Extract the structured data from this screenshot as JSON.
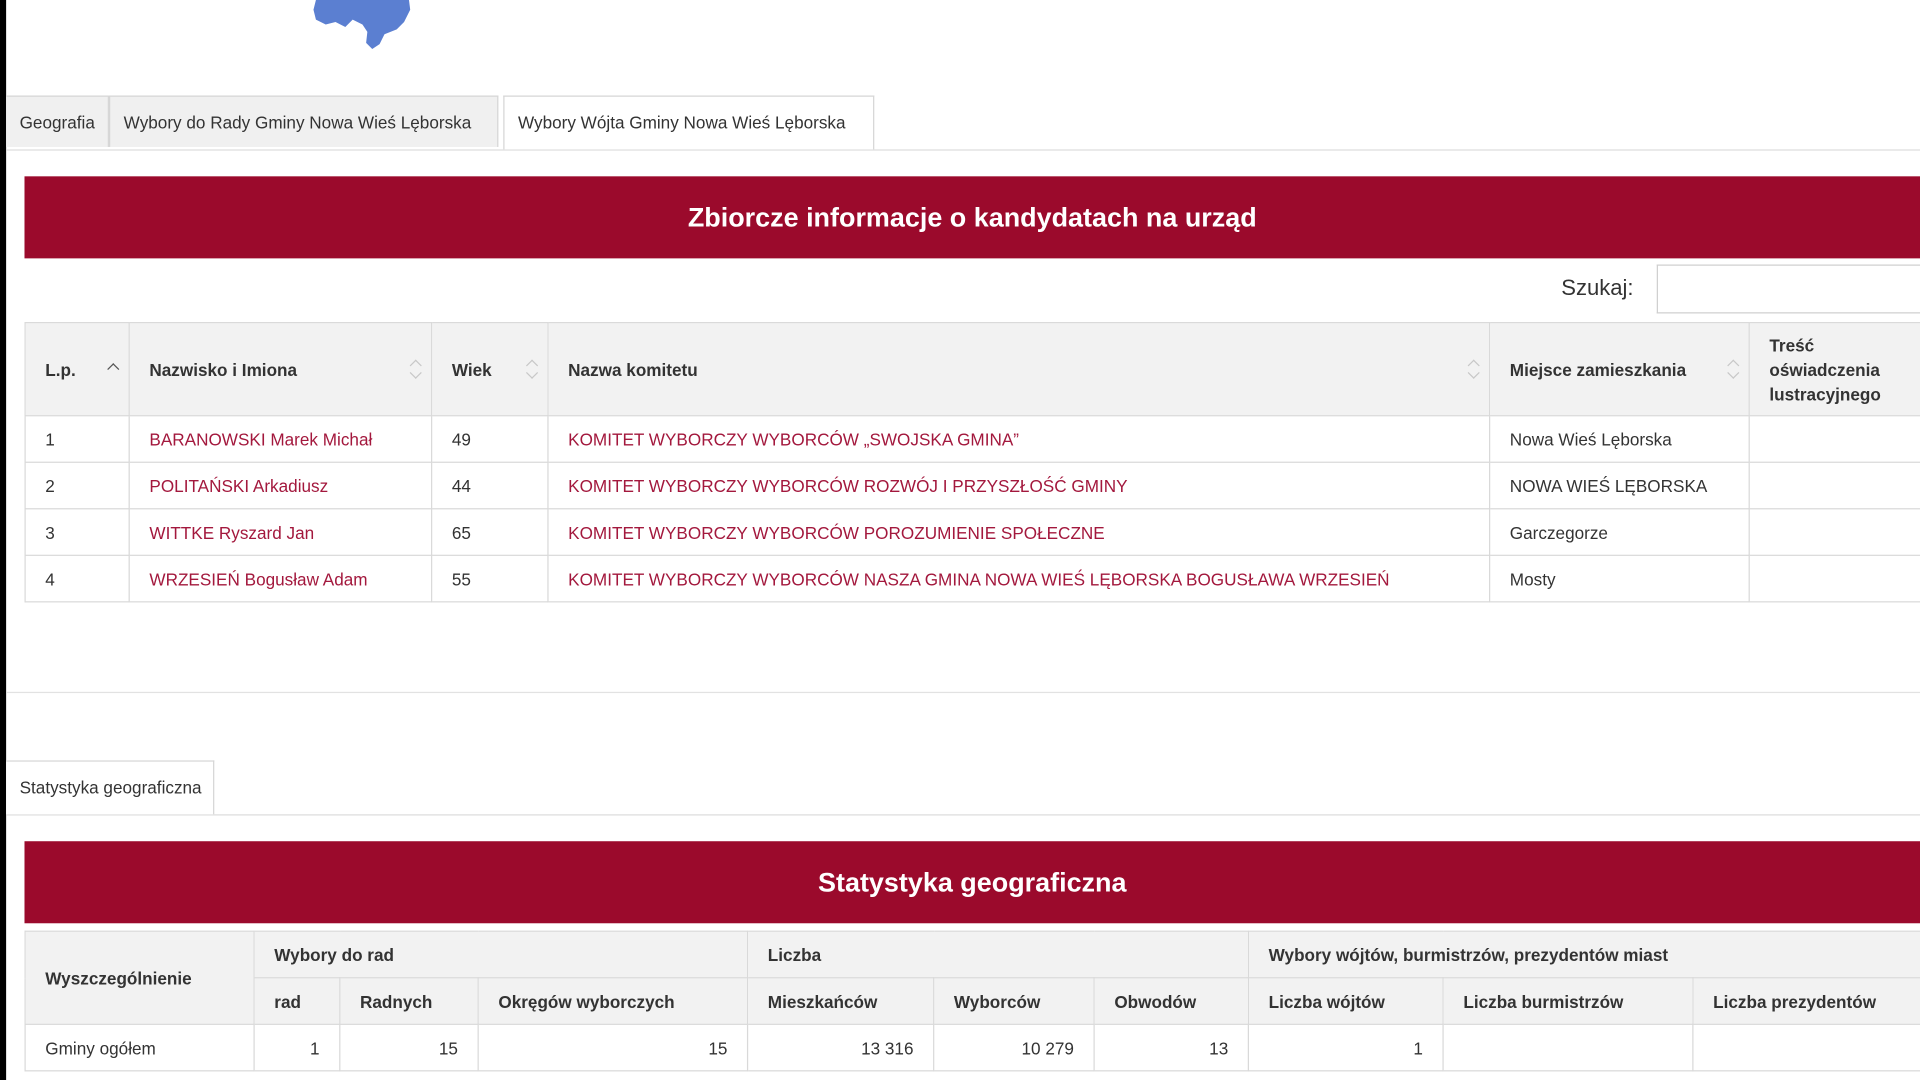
{
  "tabs": [
    {
      "label": "Geografia"
    },
    {
      "label": "Wybory do Rady Gminy Nowa Wieś Lęborska"
    },
    {
      "label": "Wybory Wójta Gminy Nowa Wieś Lęborska"
    }
  ],
  "candidates_section": {
    "title": "Zbiorcze informacje o kandydatach na urząd",
    "search_label": "Szukaj:",
    "search_value": "",
    "columns": [
      "L.p.",
      "Nazwisko i Imiona",
      "Wiek",
      "Nazwa komitetu",
      "Miejsce zamieszkania",
      "Treść oświadczenia lustracyjnego"
    ],
    "rows": [
      {
        "lp": "1",
        "name": "BARANOWSKI Marek Michał",
        "age": "49",
        "committee": "KOMITET WYBORCZY WYBORCÓW „SWOJSKA GMINA”",
        "residence": "Nowa Wieś Lęborska",
        "statement": ""
      },
      {
        "lp": "2",
        "name": "POLITAŃSKI Arkadiusz",
        "age": "44",
        "committee": "KOMITET WYBORCZY WYBORCÓW ROZWÓJ I PRZYSZŁOŚĆ GMINY",
        "residence": "NOWA WIEŚ LĘBORSKA",
        "statement": ""
      },
      {
        "lp": "3",
        "name": "WITTKE Ryszard Jan",
        "age": "65",
        "committee": "KOMITET WYBORCZY WYBORCÓW POROZUMIENIE SPOŁECZNE",
        "residence": "Garczegorze",
        "statement": ""
      },
      {
        "lp": "4",
        "name": "WRZESIEŃ Bogusław Adam",
        "age": "55",
        "committee": "KOMITET WYBORCZY WYBORCÓW NASZA GMINA NOWA WIEŚ LĘBORSKA BOGUSŁAWA WRZESIEŃ",
        "residence": "Mosty",
        "statement": ""
      }
    ]
  },
  "stats_tabs": [
    {
      "label": "Statystyka geograficzna"
    }
  ],
  "stats_section": {
    "title": "Statystyka geograficzna",
    "header_groups": {
      "label_col": "Wyszczególnienie",
      "group1": "Wybory do rad",
      "group2": "Liczba",
      "group3": "Wybory wójtów, burmistrzów, prezydentów miast"
    },
    "subcolumns": [
      "rad",
      "Radnych",
      "Okręgów wyborczych",
      "Mieszkańców",
      "Wyborców",
      "Obwodów",
      "Liczba wójtów",
      "Liczba burmistrzów",
      "Liczba prezydentów"
    ],
    "rows": [
      {
        "label": "Gminy ogółem",
        "values": [
          "1",
          "15",
          "15",
          "13 316",
          "10 279",
          "13",
          "1",
          "",
          ""
        ]
      }
    ]
  },
  "colors": {
    "accent": "#9b0a2c",
    "link": "#a3183d",
    "map": "#5b7fd1"
  }
}
